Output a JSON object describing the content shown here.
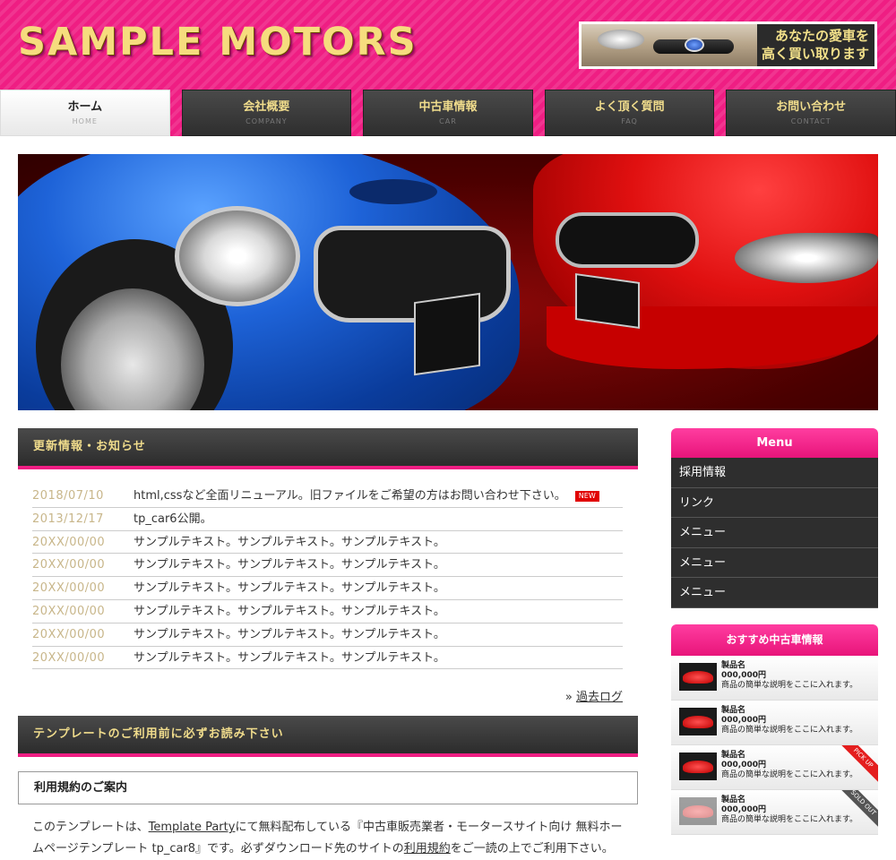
{
  "header": {
    "logo": "SAMPLE MOTORS",
    "banner_line1": "あなたの愛車を",
    "banner_line2": "高く買い取ります"
  },
  "nav": [
    {
      "label": "ホーム",
      "sub": "HOME"
    },
    {
      "label": "会社概要",
      "sub": "COMPANY"
    },
    {
      "label": "中古車情報",
      "sub": "CAR"
    },
    {
      "label": "よく頂く質問",
      "sub": "FAQ"
    },
    {
      "label": "お問い合わせ",
      "sub": "CONTACT"
    }
  ],
  "news": {
    "heading": "更新情報・お知らせ",
    "items": [
      {
        "date": "2018/07/10",
        "text": "html,cssなど全面リニューアル。旧ファイルをご希望の方はお問い合わせ下さい。",
        "badge": "NEW"
      },
      {
        "date": "2013/12/17",
        "text": "tp_car6公開。"
      },
      {
        "date": "20XX/00/00",
        "text": "サンプルテキスト。サンプルテキスト。サンプルテキスト。"
      },
      {
        "date": "20XX/00/00",
        "text": "サンプルテキスト。サンプルテキスト。サンプルテキスト。"
      },
      {
        "date": "20XX/00/00",
        "text": "サンプルテキスト。サンプルテキスト。サンプルテキスト。"
      },
      {
        "date": "20XX/00/00",
        "text": "サンプルテキスト。サンプルテキスト。サンプルテキスト。"
      },
      {
        "date": "20XX/00/00",
        "text": "サンプルテキスト。サンプルテキスト。サンプルテキスト。"
      },
      {
        "date": "20XX/00/00",
        "text": "サンプルテキスト。サンプルテキスト。サンプルテキスト。"
      }
    ],
    "past_log_prefix": "» ",
    "past_log": "過去ログ"
  },
  "template": {
    "heading": "テンプレートのご利用前に必ずお読み下さい",
    "terms_title": "利用規約のご案内",
    "text_1": "このテンプレートは、",
    "link_1": "Template Party",
    "text_2": "にて無料配布している『中古車販売業者・モータースサイト向け 無料ホームページテンプレート tp_car8』です。必ずダウンロード先のサイトの",
    "link_2": "利用規約",
    "text_3": "をご一読の上でご利用下さい。"
  },
  "side": {
    "menu_title": "Menu",
    "menu_items": [
      "採用情報",
      "リンク",
      "メニュー",
      "メニュー",
      "メニュー"
    ],
    "rec_title": "おすすめ中古車情報",
    "rec_items": [
      {
        "name": "製品名",
        "price": "000,000円",
        "desc": "商品の簡単な説明をここに入れます。"
      },
      {
        "name": "製品名",
        "price": "000,000円",
        "desc": "商品の簡単な説明をここに入れます。"
      },
      {
        "name": "製品名",
        "price": "000,000円",
        "desc": "商品の簡単な説明をここに入れます。",
        "ribbon": "PICK UP"
      },
      {
        "name": "製品名",
        "price": "000,000円",
        "desc": "商品の簡単な説明をここに入れます。",
        "ribbon": "SOLD OUT"
      }
    ]
  }
}
